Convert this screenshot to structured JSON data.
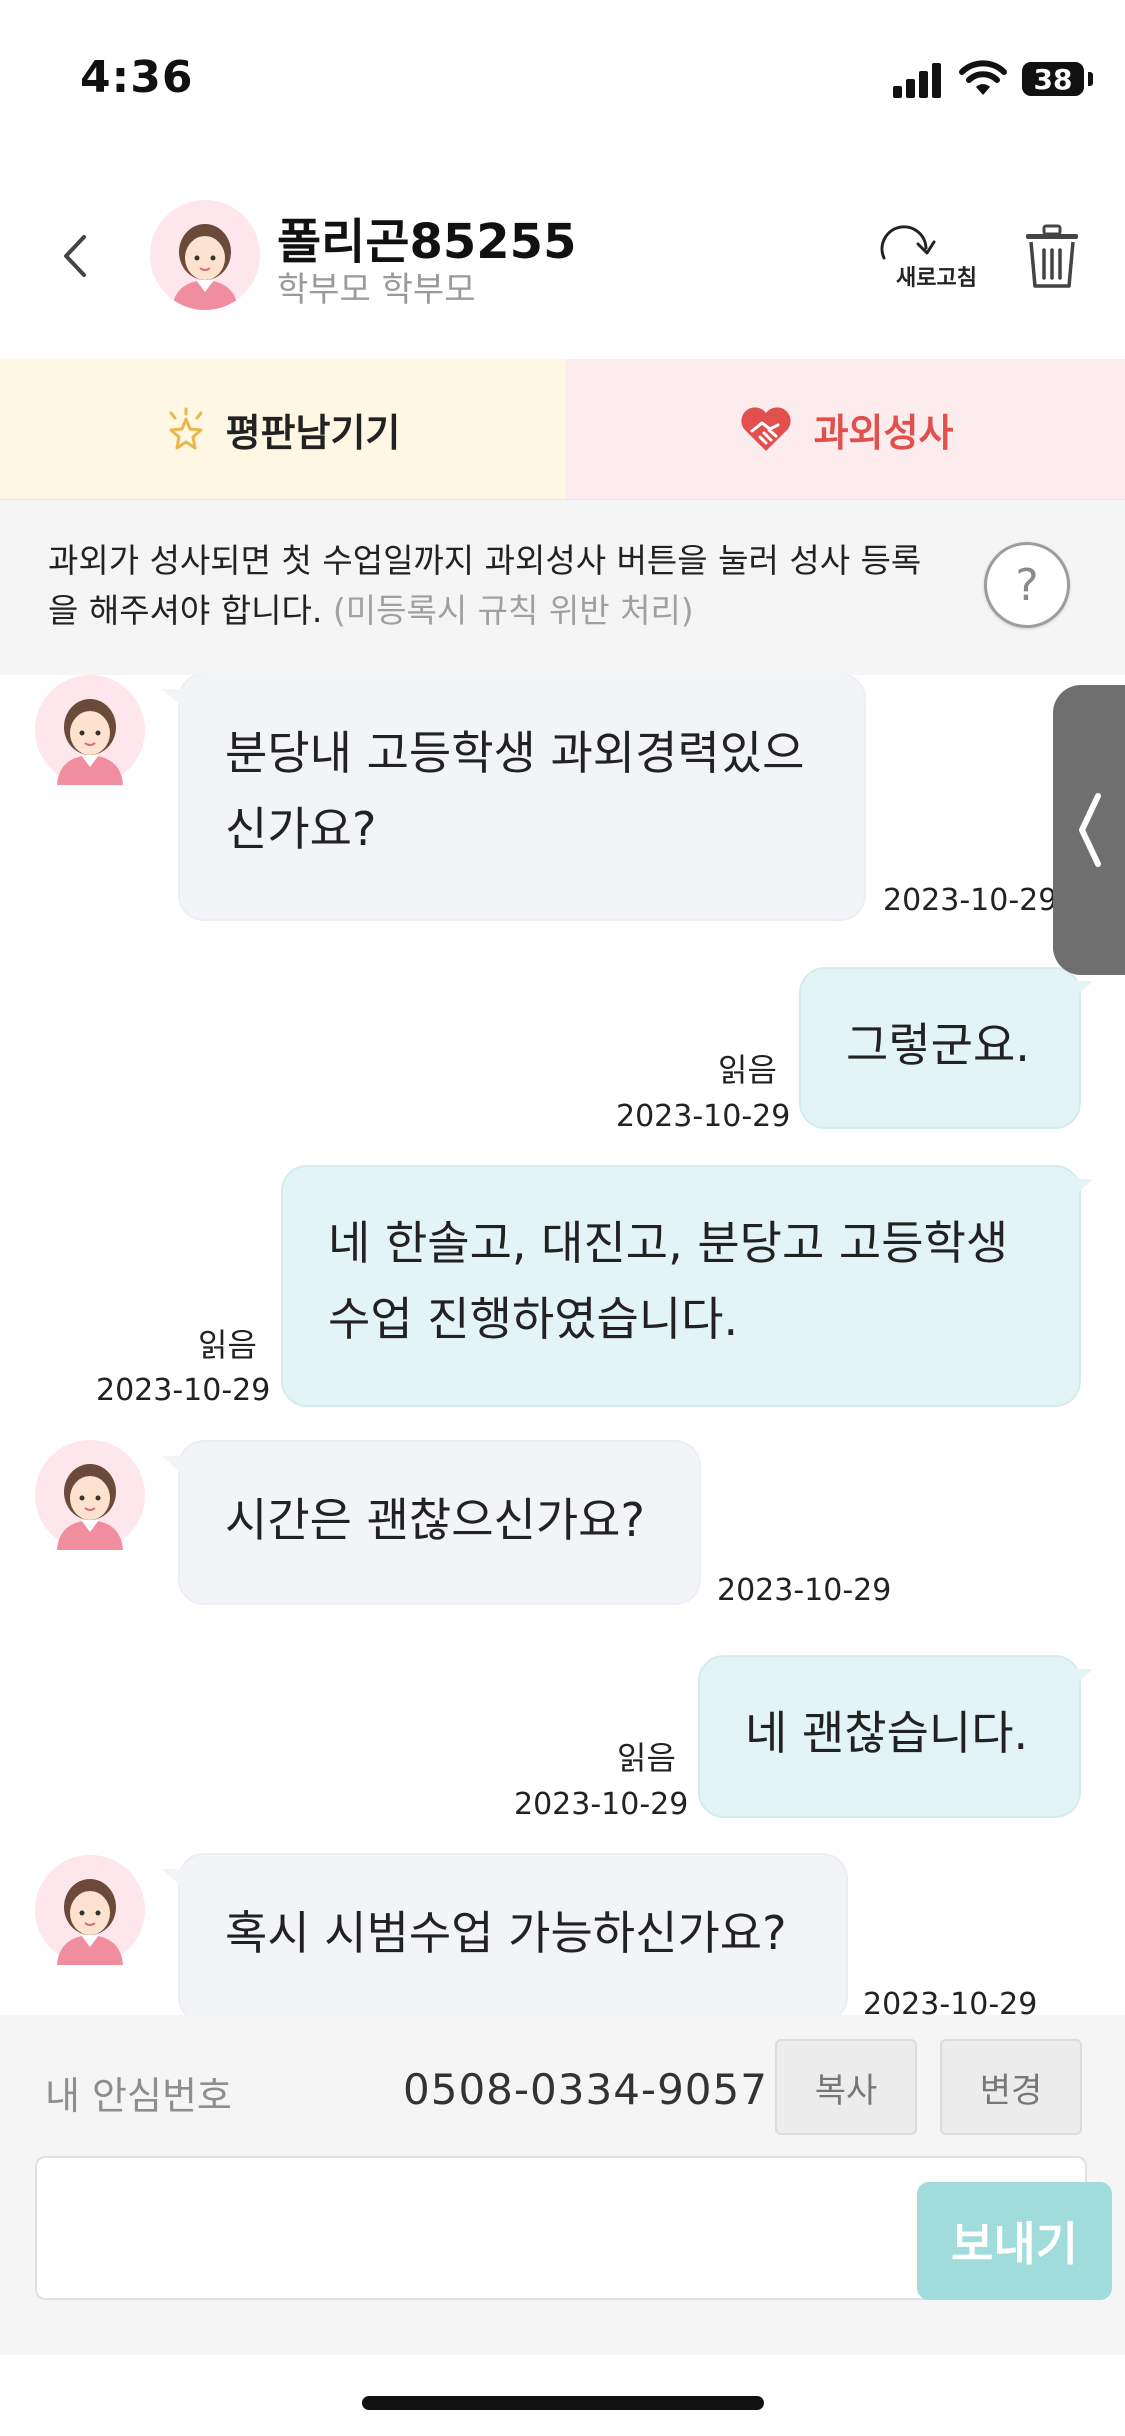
{
  "status_bar": {
    "time": "4:36",
    "battery": "38"
  },
  "header": {
    "contact_name": "폴리곤85255",
    "contact_role": "학부모 학부모",
    "refresh_label": "새로고침"
  },
  "tabs": {
    "review_label": "평판남기기",
    "success_label": "과외성사"
  },
  "notice": {
    "text": "과외가 성사되면 첫 수업일까지 과외성사 버튼을 눌러 성사 등록을 해주셔야 합니다.",
    "muted": "(미등록시 규칙 위반 처리)",
    "help": "?"
  },
  "messages": [
    {
      "direction": "in",
      "text": "분당내 고등학생 과외경력있으신가요?",
      "time": "2023-10-29"
    },
    {
      "direction": "out",
      "text": "그렇군요.",
      "read": "읽음",
      "time": "2023-10-29"
    },
    {
      "direction": "out",
      "text": "네 한솔고, 대진고, 분당고 고등학생 수업 진행하였습니다.",
      "read": "읽음",
      "time": "2023-10-29"
    },
    {
      "direction": "in",
      "text": "시간은 괜찮으신가요?",
      "time": "2023-10-29"
    },
    {
      "direction": "out",
      "text": "네 괜찮습니다.",
      "read": "읽음",
      "time": "2023-10-29"
    },
    {
      "direction": "in",
      "text": "혹시 시범수업 가능하신가요?",
      "time": "2023-10-29"
    }
  ],
  "phone_bar": {
    "label": "내 안심번호",
    "number": "0508-0334-9057",
    "copy_label": "복사",
    "change_label": "변경"
  },
  "composer": {
    "placeholder": "",
    "send_label": "보내기"
  },
  "colors": {
    "accent": "#9fdcdb",
    "success_red": "#e2504e",
    "incoming_bubble": "#f3f4f8",
    "outgoing_bubble": "#e2f4f5"
  },
  "icons": [
    "back-chevron-icon",
    "refresh-icon",
    "trash-icon",
    "star-icon",
    "handshake-heart-icon",
    "help-icon",
    "side-panel-chevron-icon"
  ]
}
